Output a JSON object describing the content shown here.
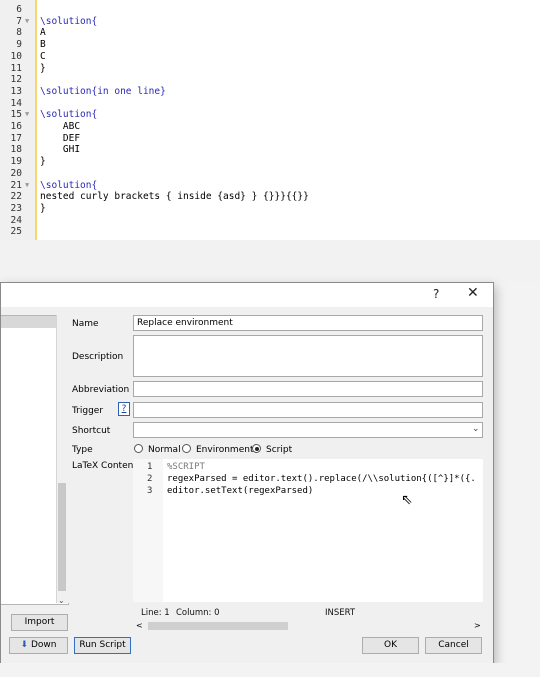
{
  "editor": {
    "lines": [
      {
        "num": "6",
        "text": "",
        "fold": false
      },
      {
        "num": "7",
        "text": "\\solution{",
        "fold": true
      },
      {
        "num": "8",
        "text": "A",
        "fold": false
      },
      {
        "num": "9",
        "text": "B",
        "fold": false
      },
      {
        "num": "10",
        "text": "C",
        "fold": false
      },
      {
        "num": "11",
        "text": "}",
        "fold": false
      },
      {
        "num": "12",
        "text": "",
        "fold": false
      },
      {
        "num": "13",
        "text": "\\solution{in one line}",
        "fold": false
      },
      {
        "num": "14",
        "text": "",
        "fold": false
      },
      {
        "num": "15",
        "text": "\\solution{",
        "fold": true
      },
      {
        "num": "16",
        "text": "    ABC",
        "fold": false
      },
      {
        "num": "17",
        "text": "    DEF",
        "fold": false
      },
      {
        "num": "18",
        "text": "    GHI",
        "fold": false
      },
      {
        "num": "19",
        "text": "}",
        "fold": false
      },
      {
        "num": "20",
        "text": "",
        "fold": false
      },
      {
        "num": "21",
        "text": "\\solution{",
        "fold": true
      },
      {
        "num": "22",
        "text": "nested curly brackets { inside {asd} } {}}}{{}}",
        "fold": false
      },
      {
        "num": "23",
        "text": "}",
        "fold": false
      },
      {
        "num": "24",
        "text": "",
        "fold": false
      },
      {
        "num": "25",
        "text": "",
        "fold": false
      }
    ]
  },
  "dialog": {
    "help": "?",
    "close": "✕",
    "labels": {
      "name": "Name",
      "description": "Description",
      "abbreviation": "Abbreviation",
      "trigger": "Trigger",
      "shortcut": "Shortcut",
      "type": "Type",
      "latex_content": "LaTeX Content"
    },
    "name_value": "Replace environment",
    "trigger_help": "?",
    "type_options": {
      "normal": "Normal",
      "environment": "Environment",
      "script": "Script"
    },
    "type_selected": "Script",
    "content_lines": [
      {
        "num": "1",
        "text": "%SCRIPT"
      },
      {
        "num": "2",
        "text": "regexParsed = editor.text().replace(/\\\\solution{([^}]*({."
      },
      {
        "num": "3",
        "text": "editor.setText(regexParsed)"
      }
    ],
    "status": {
      "line": "Line: 1",
      "column": "Column: 0",
      "mode": "INSERT"
    },
    "buttons": {
      "import": "Import",
      "down": "Down",
      "run_script": "Run Script",
      "ok": "OK",
      "cancel": "Cancel"
    }
  }
}
